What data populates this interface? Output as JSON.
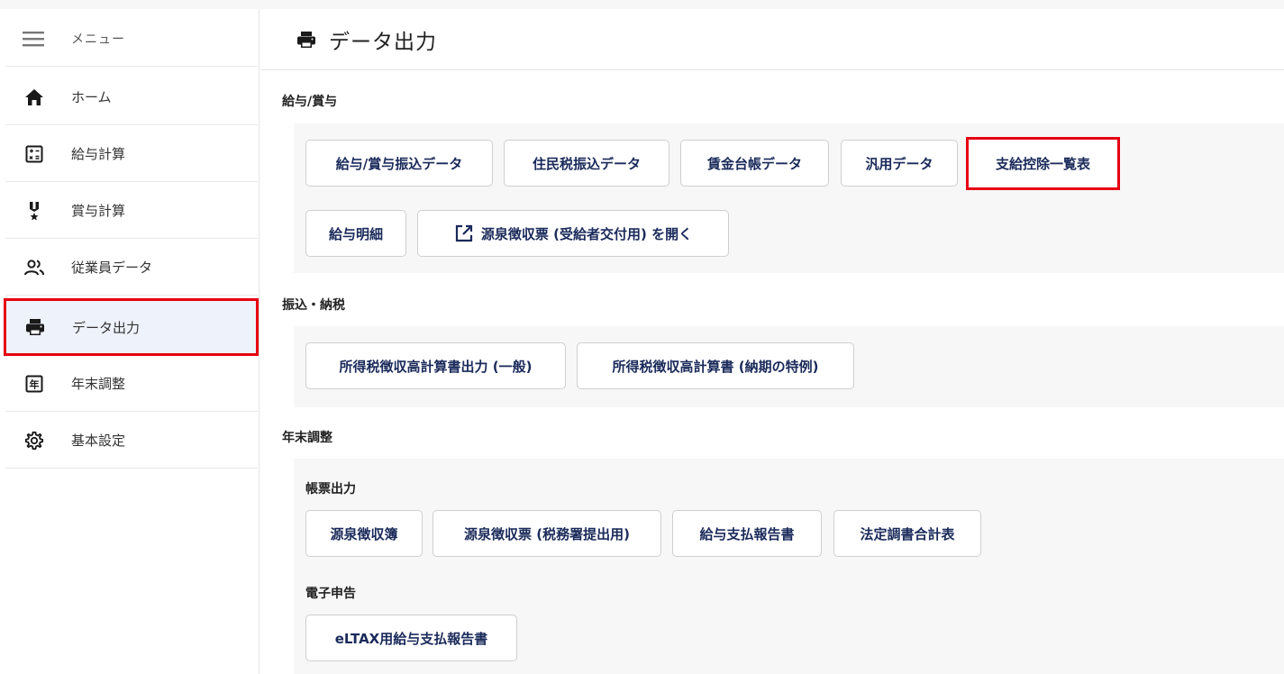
{
  "sidebar": {
    "menu_label": "メニュー",
    "items": [
      {
        "label": "ホーム",
        "icon": "home-icon"
      },
      {
        "label": "給与計算",
        "icon": "calculator-icon"
      },
      {
        "label": "賞与計算",
        "icon": "medal-icon"
      },
      {
        "label": "従業員データ",
        "icon": "people-icon"
      },
      {
        "label": "データ出力",
        "icon": "printer-icon",
        "active": true
      },
      {
        "label": "年末調整",
        "icon": "year-calendar-icon"
      },
      {
        "label": "基本設定",
        "icon": "gear-icon"
      }
    ]
  },
  "header": {
    "title": "データ出力",
    "icon": "printer-icon"
  },
  "sections": {
    "kyuyo": {
      "title": "給与/賞与",
      "buttons": [
        "給与/賞与振込データ",
        "住民税振込データ",
        "賃金台帳データ",
        "汎用データ",
        "支給控除一覧表",
        "給与明細",
        "源泉徴収票 (受給者交付用) を開く"
      ]
    },
    "furikomi": {
      "title": "振込・納税",
      "buttons": [
        "所得税徴収高計算書出力 (一般)",
        "所得税徴収高計算書 (納期の特例)"
      ]
    },
    "nenmatsu": {
      "title": "年末調整",
      "sub1_title": "帳票出力",
      "sub1_buttons": [
        "源泉徴収簿",
        "源泉徴収票 (税務署提出用)",
        "給与支払報告書",
        "法定調書合計表"
      ],
      "sub2_title": "電子申告",
      "sub2_buttons": [
        "eLTAX用給与支払報告書"
      ]
    }
  },
  "colors": {
    "highlight": "#e60012",
    "button_text": "#1a2a5a",
    "active_bg": "#eef2fb",
    "panel_bg": "#f7f7f7"
  }
}
